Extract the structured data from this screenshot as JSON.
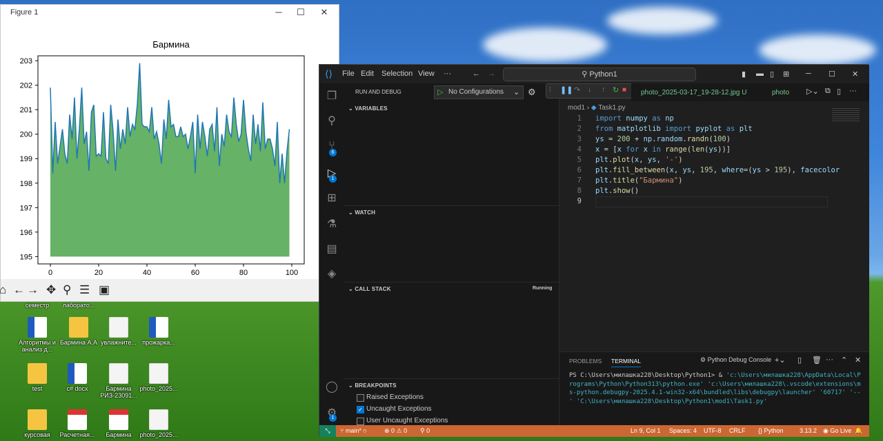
{
  "figure": {
    "window_title": "Figure 1",
    "chart_data": {
      "type": "area",
      "title": "Бармина",
      "xlabel": "",
      "ylabel": "",
      "baseline": 195,
      "xlim": [
        0,
        100
      ],
      "ylim": [
        194.7,
        203.2
      ],
      "xticks": [
        "0",
        "20",
        "40",
        "60",
        "80",
        "100"
      ],
      "yticks": [
        "195",
        "196",
        "197",
        "198",
        "199",
        "200",
        "201",
        "202",
        "203"
      ],
      "line_color": "#1f77b4",
      "fill_color": "#66b266",
      "y": [
        201.9,
        198.4,
        200.5,
        198.8,
        199.5,
        200.2,
        199.2,
        198.8,
        200.8,
        199.8,
        201.5,
        199.0,
        200.2,
        201.9,
        199.6,
        200.1,
        198.5,
        200.9,
        201.2,
        199.1,
        199.2,
        199.1,
        200.9,
        199.0,
        198.8,
        201.2,
        200.1,
        198.5,
        200.6,
        199.4,
        200.2,
        199.6,
        201.1,
        199.9,
        200.4,
        200.2,
        201.2,
        202.9,
        200.4,
        200.3,
        200.3,
        200.1,
        201.1,
        199.8,
        200.1,
        199.6,
        198.8,
        200.6,
        199.8,
        201.4,
        200.3,
        200.4,
        199.9,
        199.9,
        200.3,
        199.9,
        200.0,
        199.4,
        199.9,
        200.5,
        198.4,
        200.8,
        199.4,
        200.5,
        199.9,
        199.1,
        200.2,
        200.4,
        199.3,
        201.1,
        198.7,
        200.0,
        199.5,
        200.8,
        200.1,
        199.9,
        201.5,
        200.4,
        199.7,
        200.0,
        201.4,
        200.1,
        199.4,
        198.9,
        200.8,
        199.6,
        200.4,
        199.3,
        201.3,
        199.4,
        199.8,
        199.8,
        199.4,
        198.7,
        200.5,
        198.0,
        199.2,
        198.0,
        199.3,
        200.2
      ]
    },
    "toolbar_icons": [
      "home-icon",
      "back-icon",
      "forward-icon",
      "pan-icon",
      "zoom-icon",
      "configure-icon",
      "save-icon"
    ]
  },
  "desktop_icons": [
    {
      "label": "семестр",
      "kind": "folder"
    },
    {
      "label": "лаборато...",
      "kind": "folder"
    },
    {
      "label": "Алгоритмы и анализ д...",
      "kind": "word"
    },
    {
      "label": "Бармина А.А",
      "kind": "folder"
    },
    {
      "label": "увлажните...",
      "kind": "img"
    },
    {
      "label": "прожарка...",
      "kind": "word"
    },
    {
      "label": "test",
      "kind": "folder"
    },
    {
      "label": "c# docx",
      "kind": "word"
    },
    {
      "label": "Бармина РИЗ-23091...",
      "kind": "img"
    },
    {
      "label": "photo_2025...",
      "kind": "img"
    },
    {
      "label": "курсовая",
      "kind": "folder"
    },
    {
      "label": "Расчетная...",
      "kind": "pdf"
    },
    {
      "label": "Бармина",
      "kind": "pdf"
    },
    {
      "label": "photo_2025...",
      "kind": "img"
    }
  ],
  "vscode": {
    "menu": [
      "File",
      "Edit",
      "Selection",
      "View",
      "···"
    ],
    "search": "Python1",
    "sidebar": {
      "title": "RUN AND DEBUG",
      "config": "No Configurations",
      "sections": {
        "variables": "VARIABLES",
        "watch": "WATCH",
        "callstack": "CALL STACK",
        "callstack_status": "Running",
        "breakpoints": "BREAKPOINTS"
      },
      "breakpoints": [
        {
          "label": "Raised Exceptions",
          "checked": false
        },
        {
          "label": "Uncaught Exceptions",
          "checked": true
        },
        {
          "label": "User Uncaught Exceptions",
          "checked": false
        }
      ]
    },
    "tabs": [
      {
        "label": "photo_2025-03-17_19-28-12.jpg",
        "status": "U"
      },
      {
        "label": "photo"
      }
    ],
    "breadcrumb": [
      "mod1",
      "Task1.py"
    ],
    "activity_badges": {
      "source_control": "6",
      "run": "1",
      "accounts": "1"
    },
    "code_lines": [
      "1",
      "2",
      "3",
      "4",
      "5",
      "6",
      "7",
      "8",
      "9"
    ],
    "panel": {
      "tabs": [
        "PROBLEMS",
        "TERMINAL"
      ],
      "active_tab": "TERMINAL",
      "console_name": "Python Debug Console",
      "prompt": "PS C:\\Users\\милашка228\\Desktop\\Python1> & ",
      "command": "'c:\\Users\\милашка228\\AppData\\Local\\Programs\\Python\\Python313\\python.exe' 'c:\\Users\\милашка228\\.vscode\\extensions\\ms-python.debugpy-2025.4.1-win32-x64\\bundled\\libs\\debugpy\\launcher' '60717' '--' 'C:\\Users\\милашка228\\Desktop\\Python1\\mod1\\Task1.py'"
    },
    "status": {
      "branch": "main*",
      "errors": "0",
      "warnings": "0",
      "ports": "0",
      "position": "Ln 9, Col 1",
      "spaces": "Spaces: 4",
      "encoding": "UTF-8",
      "eol": "CRLF",
      "language": "{} Python",
      "version": "3.13.2",
      "golive": "Go Live",
      "accent": "#cc6633"
    }
  }
}
